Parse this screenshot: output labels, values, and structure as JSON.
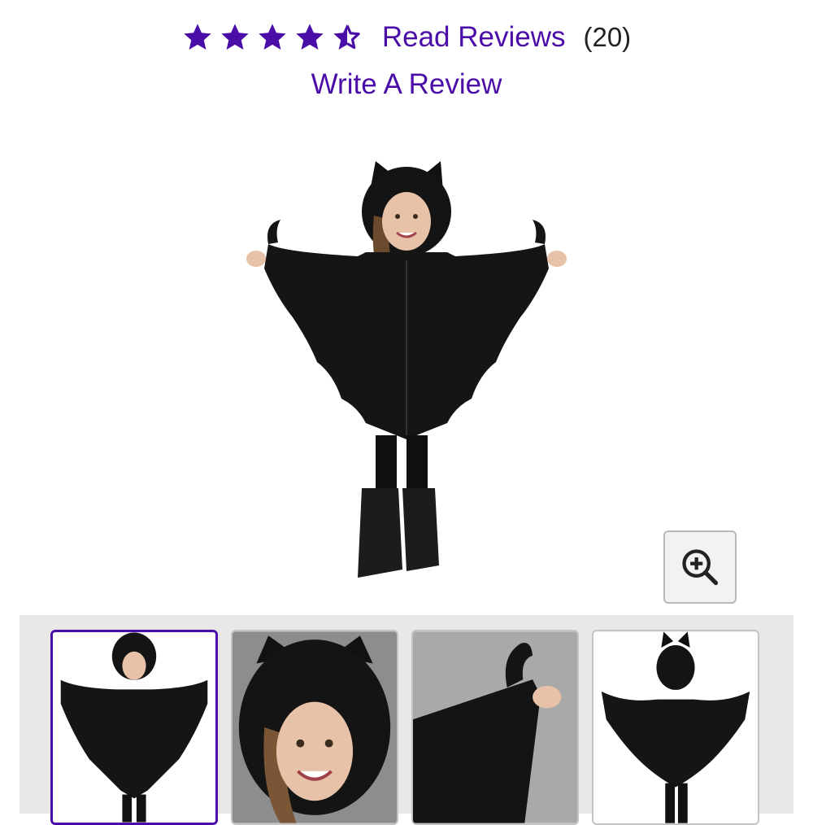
{
  "rating": {
    "stars_filled": 4.5,
    "stars_max": 5,
    "read_reviews_label": "Read Reviews",
    "review_count": "(20)",
    "write_review_label": "Write A Review"
  },
  "colors": {
    "accent": "#4b0da8",
    "thumb_strip_bg": "#e8e8e8"
  },
  "icons": {
    "zoom": "zoom-in-icon",
    "star": "star-icon",
    "half_star": "half-star-icon"
  },
  "thumbnails": [
    {
      "name": "thumb-front-full",
      "active": true
    },
    {
      "name": "thumb-hood-closeup",
      "active": false
    },
    {
      "name": "thumb-wing-detail",
      "active": false
    },
    {
      "name": "thumb-back-view",
      "active": false
    }
  ]
}
